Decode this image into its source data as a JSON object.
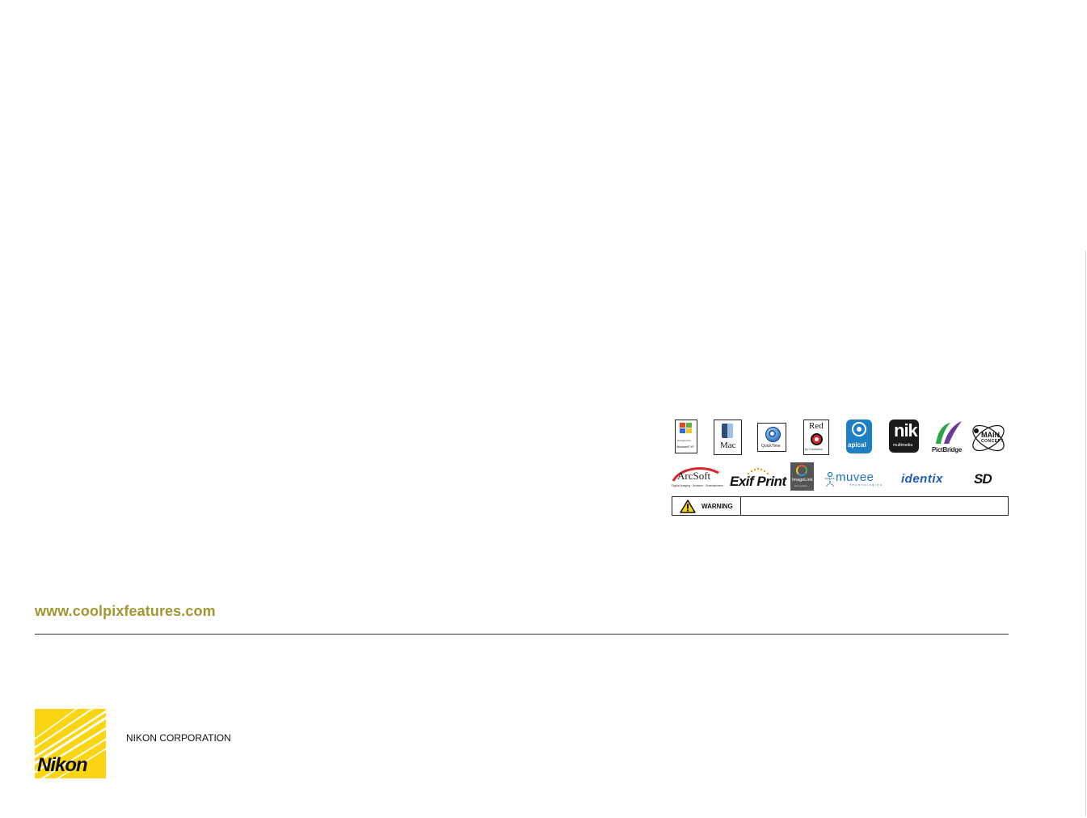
{
  "logos": {
    "windows": {
      "line1": "Designed for",
      "line2": "Windows® XP"
    },
    "mac": {
      "label": "Mac"
    },
    "quicktime": {
      "label": "QuickTime"
    },
    "red_eye": {
      "label": "Red",
      "sub": "by FotoNation"
    },
    "apical": {
      "label": "apical"
    },
    "nik": {
      "label": "nik",
      "sub": "multimedia"
    },
    "pictbridge": {
      "label": "PictBridge"
    },
    "mainconcept": {
      "line1": "MAIN",
      "line2": "CONCEPT"
    },
    "arcsoft": {
      "label": "ArcSoft",
      "sub": "Digital Imaging · Browser · Entertainment"
    },
    "exif_print": {
      "label": "Exif Print"
    },
    "imagelink": {
      "label": "ImageLink",
      "sub": "print system"
    },
    "muvee": {
      "label": "muvee",
      "sub": "technologies"
    },
    "identix": {
      "label": "identix"
    },
    "sd": {
      "label": "SD"
    }
  },
  "warning": {
    "label": "WARNING",
    "text": ""
  },
  "footer": {
    "website": "www.coolpixfeatures.com",
    "corporation": "NIKON CORPORATION",
    "brand": "Nikon"
  },
  "colors": {
    "website_text": "#a19633",
    "nikon_yellow": "#fbd512"
  }
}
